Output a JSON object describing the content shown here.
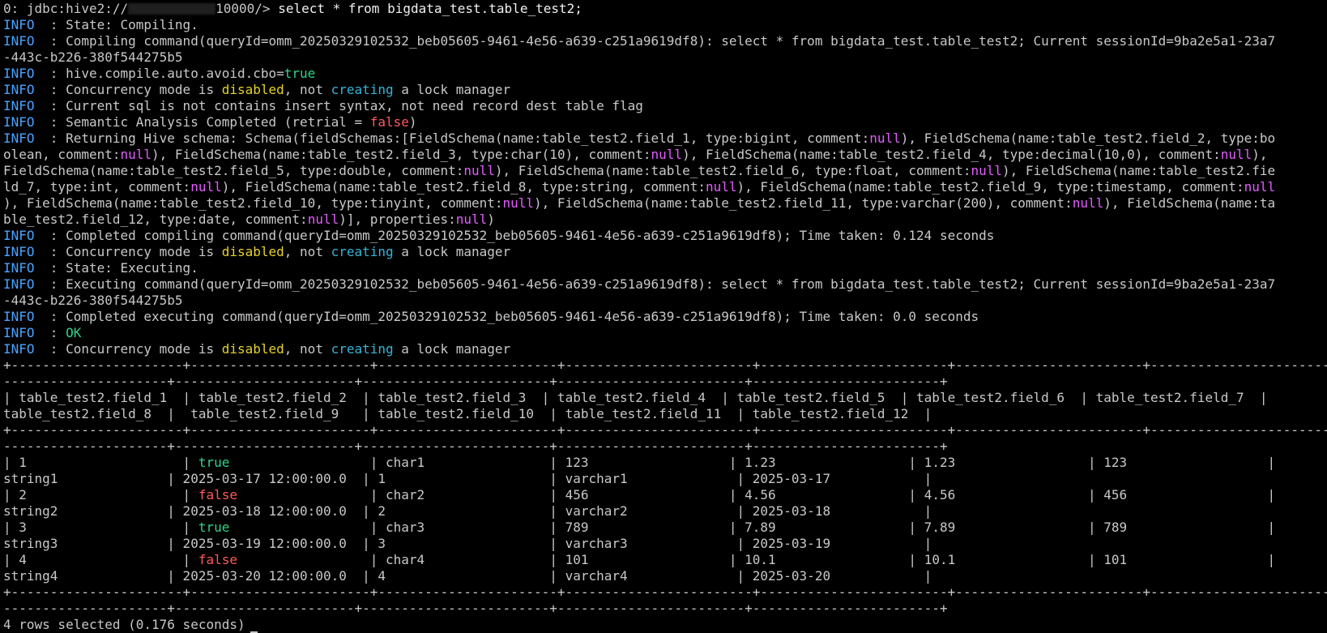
{
  "terminal": {
    "prompt": {
      "prefix": "0: jdbc:hive2://",
      "suffix": "10000/>",
      "command": "select * from bigdata_test.table_test2;"
    },
    "log": {
      "level": "INFO",
      "lines": [
        [
          {
            "t": "  : State: Compiling."
          }
        ],
        [
          {
            "t": "  : Compiling command(queryId=omm_20250329102532_beb05605-9461-4e56-a639-c251a9619df8): select * from bigdata_test.table_test2; Current sessionId=9ba2e5a1-23a7"
          }
        ],
        [
          {
            "t": "-443c-b226-380f544275b5",
            "noLevel": true
          }
        ],
        [
          {
            "t": "  : hive.compile.auto.avoid.cbo="
          },
          {
            "t": "true",
            "c": "green"
          }
        ],
        [
          {
            "t": "  : Concurrency mode is "
          },
          {
            "t": "disabled",
            "c": "yellow"
          },
          {
            "t": ", not "
          },
          {
            "t": "creating",
            "c": "cyan"
          },
          {
            "t": " a lock manager"
          }
        ],
        [
          {
            "t": "  : Current sql is not contains insert syntax, not need record dest table flag"
          }
        ],
        [
          {
            "t": "  : Semantic Analysis Completed (retrial = "
          },
          {
            "t": "false",
            "c": "red"
          },
          {
            "t": ")"
          }
        ],
        [
          {
            "t": "  : Returning Hive schema: Schema(fieldSchemas:[FieldSchema(name:table_test2.field_1, type:bigint, comment:"
          },
          {
            "t": "null",
            "c": "magenta"
          },
          {
            "t": "), FieldSchema(name:table_test2.field_2, type:bo"
          }
        ],
        [
          {
            "t": "olean, comment:",
            "noLevel": true
          },
          {
            "t": "null",
            "c": "magenta"
          },
          {
            "t": "), FieldSchema(name:table_test2.field_3, type:char(10), comment:"
          },
          {
            "t": "null",
            "c": "magenta"
          },
          {
            "t": "), FieldSchema(name:table_test2.field_4, type:decimal(10,0), comment:"
          },
          {
            "t": "null",
            "c": "magenta"
          },
          {
            "t": "),"
          }
        ],
        [
          {
            "t": "FieldSchema(name:table_test2.field_5, type:double, comment:",
            "noLevel": true
          },
          {
            "t": "null",
            "c": "magenta"
          },
          {
            "t": "), FieldSchema(name:table_test2.field_6, type:float, comment:"
          },
          {
            "t": "null",
            "c": "magenta"
          },
          {
            "t": "), FieldSchema(name:table_test2.fie"
          }
        ],
        [
          {
            "t": "ld_7, type:int, comment:",
            "noLevel": true
          },
          {
            "t": "null",
            "c": "magenta"
          },
          {
            "t": "), FieldSchema(name:table_test2.field_8, type:string, comment:"
          },
          {
            "t": "null",
            "c": "magenta"
          },
          {
            "t": "), FieldSchema(name:table_test2.field_9, type:timestamp, comment:"
          },
          {
            "t": "null",
            "c": "magenta"
          }
        ],
        [
          {
            "t": "), FieldSchema(name:table_test2.field_10, type:tinyint, comment:",
            "noLevel": true
          },
          {
            "t": "null",
            "c": "magenta"
          },
          {
            "t": "), FieldSchema(name:table_test2.field_11, type:varchar(200), comment:"
          },
          {
            "t": "null",
            "c": "magenta"
          },
          {
            "t": "), FieldSchema(name:ta"
          }
        ],
        [
          {
            "t": "ble_test2.field_12, type:date, comment:",
            "noLevel": true
          },
          {
            "t": "null",
            "c": "magenta"
          },
          {
            "t": ")], properties:"
          },
          {
            "t": "null",
            "c": "magenta"
          },
          {
            "t": ")"
          }
        ],
        [
          {
            "t": "  : Completed compiling command(queryId=omm_20250329102532_beb05605-9461-4e56-a639-c251a9619df8); Time taken: 0.124 seconds"
          }
        ],
        [
          {
            "t": "  : Concurrency mode is "
          },
          {
            "t": "disabled",
            "c": "yellow"
          },
          {
            "t": ", not "
          },
          {
            "t": "creating",
            "c": "cyan"
          },
          {
            "t": " a lock manager"
          }
        ],
        [
          {
            "t": "  : State: Executing."
          }
        ],
        [
          {
            "t": "  : Executing command(queryId=omm_20250329102532_beb05605-9461-4e56-a639-c251a9619df8): select * from bigdata_test.table_test2; Current sessionId=9ba2e5a1-23a7"
          }
        ],
        [
          {
            "t": "-443c-b226-380f544275b5",
            "noLevel": true
          }
        ],
        [
          {
            "t": "  : Completed executing command(queryId=omm_20250329102532_beb05605-9461-4e56-a639-c251a9619df8); Time taken: 0.0 seconds"
          }
        ],
        [
          {
            "t": "  : "
          },
          {
            "t": "OK",
            "c": "green"
          }
        ],
        [
          {
            "t": "  : Concurrency mode is "
          },
          {
            "t": "disabled",
            "c": "yellow"
          },
          {
            "t": ", not "
          },
          {
            "t": "creating",
            "c": "cyan"
          },
          {
            "t": " a lock manager"
          }
        ]
      ]
    },
    "table": {
      "separator_1": "+----------------------+-----------------------+-----------------------+------------------------+------------------------+------------------------+-----------------------+",
      "separator_2": "---------------------+-----------------------+------------------------+------------------------+------------------------+",
      "header_1": "| table_test2.field_1  | table_test2.field_2  | table_test2.field_3  | table_test2.field_4  | table_test2.field_5  | table_test2.field_6  | table_test2.field_7  |",
      "header_2": "table_test2.field_8  |  table_test2.field_9   | table_test2.field_10  | table_test2.field_11  | table_test2.field_12  |",
      "rows": [
        [
          [
            {
              "t": "| 1                    | "
            },
            {
              "t": "true",
              "c": "green"
            },
            {
              "t": "                  | char1                | 123                  | 1.23                 | 1.23                 | 123                  |"
            }
          ],
          [
            {
              "t": "string1              | 2025-03-17 12:00:00.0  | 1                     | varchar1              | 2025-03-17            |"
            }
          ]
        ],
        [
          [
            {
              "t": "| 2                    | "
            },
            {
              "t": "false",
              "c": "red"
            },
            {
              "t": "                 | char2                | 456                  | 4.56                 | 4.56                 | 456                  |"
            }
          ],
          [
            {
              "t": "string2              | 2025-03-18 12:00:00.0  | 2                     | varchar2              | 2025-03-18            |"
            }
          ]
        ],
        [
          [
            {
              "t": "| 3                    | "
            },
            {
              "t": "true",
              "c": "green"
            },
            {
              "t": "                  | char3                | 789                  | 7.89                 | 7.89                 | 789                  |"
            }
          ],
          [
            {
              "t": "string3              | 2025-03-19 12:00:00.0  | 3                     | varchar3              | 2025-03-19            |"
            }
          ]
        ],
        [
          [
            {
              "t": "| 4                    | "
            },
            {
              "t": "false",
              "c": "red"
            },
            {
              "t": "                 | char4                | 101                  | 10.1                 | 10.1                 | 101                  |"
            }
          ],
          [
            {
              "t": "string4              | 2025-03-20 12:00:00.0  | 4                     | varchar4              | 2025-03-20            |"
            }
          ]
        ]
      ]
    },
    "footer": "4 rows selected (0.176 seconds)"
  },
  "colors": {
    "background": "#000000",
    "text": "#c8c8c8",
    "info": "#4aa3ff",
    "yellow": "#e5d22c",
    "cyan": "#35b4d8",
    "green": "#2ed38a",
    "red": "#ff5a5a",
    "magenta": "#e35cff",
    "underline": "#d52020"
  }
}
